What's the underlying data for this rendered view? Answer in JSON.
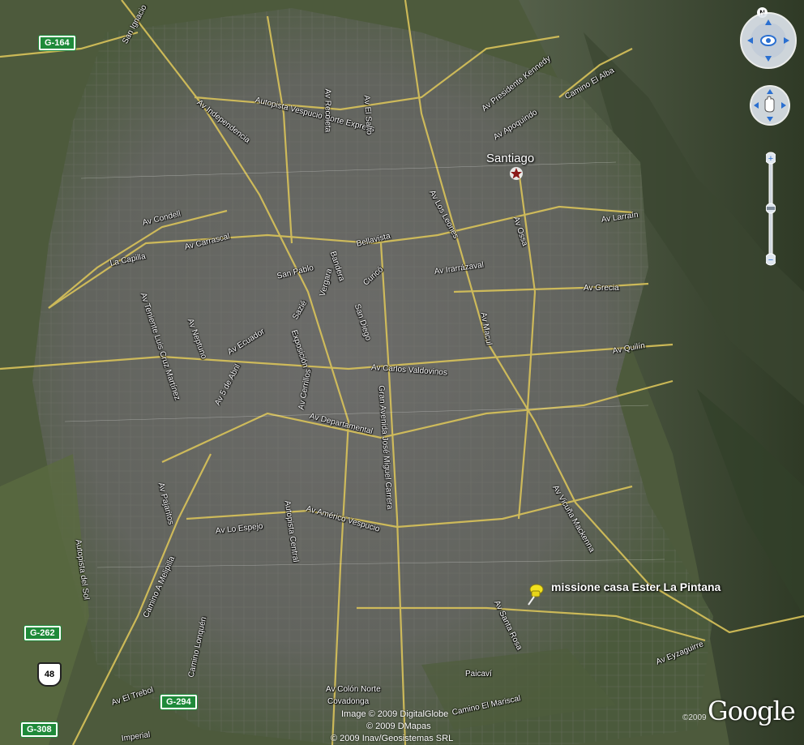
{
  "city": {
    "name": "Santiago"
  },
  "placemark": {
    "label": "missione casa Ester La Pintana"
  },
  "route_shields": [
    {
      "label": "G-164",
      "kind": "green"
    },
    {
      "label": "G-262",
      "kind": "green"
    },
    {
      "label": "48",
      "kind": "us"
    },
    {
      "label": "G-294",
      "kind": "green"
    },
    {
      "label": "G-308",
      "kind": "green"
    }
  ],
  "road_labels": [
    "San Ignacio",
    "Av Independencia",
    "Autopista Vespucio Norte Express",
    "Av Recoleta",
    "Av El Salto",
    "Av Presidente Kennedy",
    "Camino El Alba",
    "Av Apoquindo",
    "Av Los Leones",
    "Av Ossa",
    "Av Larraín",
    "Av Condell",
    "Av Carrascal",
    "La Capilla",
    "Bellavista",
    "Av Irarrázaval",
    "Av Grecia",
    "San Pablo",
    "Bandera",
    "Curicó",
    "Vergara",
    "Sazié",
    "Exposición",
    "San Diego",
    "Av Ecuador",
    "Av Teniente Luis Cruz Martínez",
    "Av Neptuno",
    "Av 5 de Abril",
    "Av Carlos Valdovinos",
    "Av Macul",
    "Av Quilín",
    "Gran Avenida José Miguel Carrera",
    "Av Departamental",
    "Av Cerrillos",
    "Av Pajaritos",
    "Autopista Central",
    "Av Américo Vespucio",
    "Av Lo Espejo",
    "Av Vicuña Mackenna",
    "Autopista del Sol",
    "Camino A Melipilla",
    "Camino Lonquén",
    "Av Santa Rosa",
    "Av Eyzaguirre",
    "Av El Trebol",
    "Paicaví",
    "Av Colón Norte",
    "Covadonga",
    "Camino El Mariscal",
    "Imperial"
  ],
  "attribution": {
    "line1": "Image © 2009 DigitalGlobe",
    "line2": "© 2009 DMapas",
    "line3": "© 2009 Inav/Geosistemas SRL",
    "year": "©2009",
    "logo": "Google"
  },
  "controls": {
    "north_label": "N",
    "zoom_in": "+",
    "zoom_out": "−"
  },
  "colors": {
    "road": "#d9c35a",
    "terrain": "#3f4a34",
    "urban": "#6f6f6b",
    "shield_green": "#1f8a3a",
    "pin": "#f2e21e",
    "star": "#8b1a1a"
  }
}
